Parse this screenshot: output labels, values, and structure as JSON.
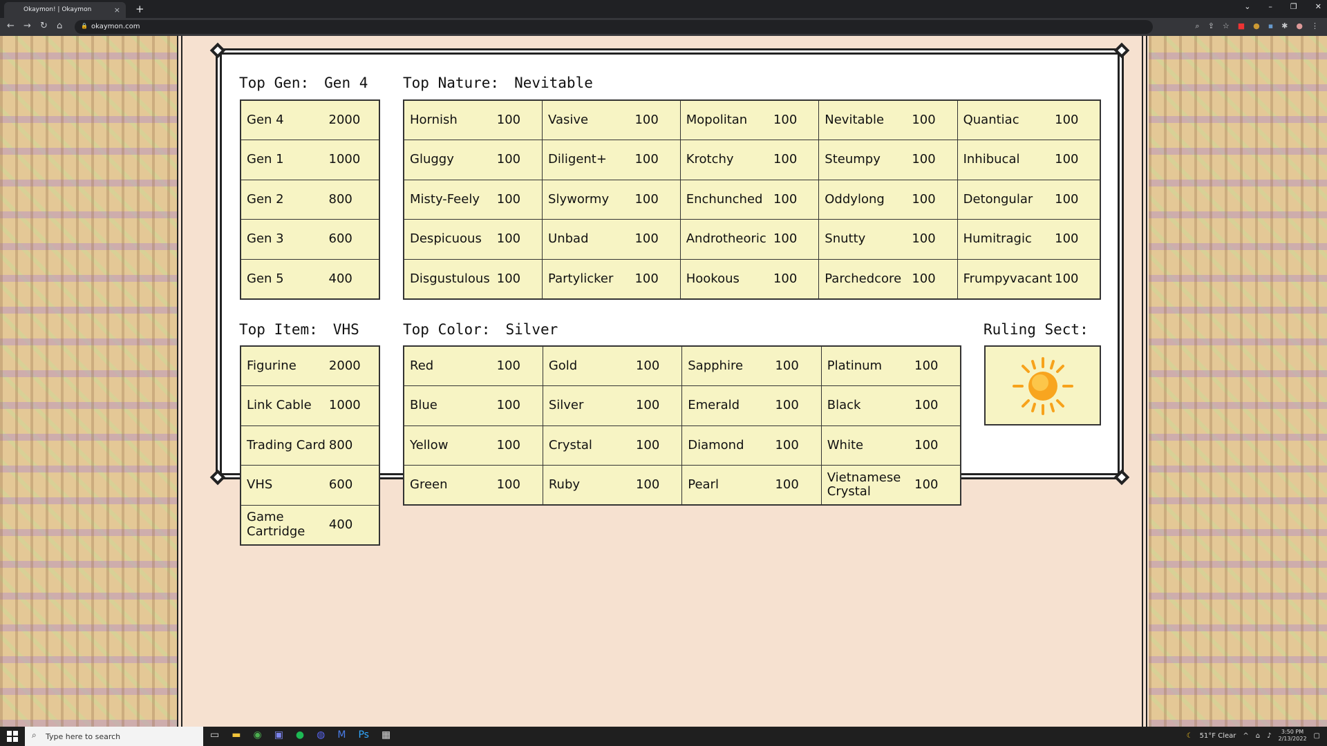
{
  "browser": {
    "tab_title": "Okaymon! | Okaymon",
    "url": "okaymon.com",
    "new_tab": "+",
    "tab_close": "×"
  },
  "panel": {
    "gen": {
      "label": "Top Gen:",
      "value": "Gen 4",
      "rows": [
        {
          "name": "Gen 4",
          "value": "2000"
        },
        {
          "name": "Gen 1",
          "value": "1000"
        },
        {
          "name": "Gen 2",
          "value": "800"
        },
        {
          "name": "Gen 3",
          "value": "600"
        },
        {
          "name": "Gen 5",
          "value": "400"
        }
      ]
    },
    "nature": {
      "label": "Top Nature:",
      "value": "Nevitable",
      "rows": [
        [
          {
            "name": "Hornish",
            "value": "100"
          },
          {
            "name": "Vasive",
            "value": "100"
          },
          {
            "name": "Mopolitan",
            "value": "100"
          },
          {
            "name": "Nevitable",
            "value": "100"
          },
          {
            "name": "Quantiac",
            "value": "100"
          }
        ],
        [
          {
            "name": "Gluggy",
            "value": "100"
          },
          {
            "name": "Diligent+",
            "value": "100"
          },
          {
            "name": "Krotchy",
            "value": "100"
          },
          {
            "name": "Steumpy",
            "value": "100"
          },
          {
            "name": "Inhibucal",
            "value": "100"
          }
        ],
        [
          {
            "name": "Misty-Feely",
            "value": "100"
          },
          {
            "name": "Slywormy",
            "value": "100"
          },
          {
            "name": "Enchunched",
            "value": "100"
          },
          {
            "name": "Oddylong",
            "value": "100"
          },
          {
            "name": "Detongular",
            "value": "100"
          }
        ],
        [
          {
            "name": "Despicuous",
            "value": "100"
          },
          {
            "name": "Unbad",
            "value": "100"
          },
          {
            "name": "Androtheoric",
            "value": "100"
          },
          {
            "name": "Snutty",
            "value": "100"
          },
          {
            "name": "Humitragic",
            "value": "100"
          }
        ],
        [
          {
            "name": "Disgustulous",
            "value": "100"
          },
          {
            "name": "Partylicker",
            "value": "100"
          },
          {
            "name": "Hookous",
            "value": "100"
          },
          {
            "name": "Parchedcore",
            "value": "100"
          },
          {
            "name": "Frumpyvacant",
            "value": "100"
          }
        ]
      ]
    },
    "item": {
      "label": "Top Item:",
      "value": "VHS",
      "rows": [
        {
          "name": "Figurine",
          "value": "2000"
        },
        {
          "name": "Link Cable",
          "value": "1000"
        },
        {
          "name": "Trading Card",
          "value": "800"
        },
        {
          "name": "VHS",
          "value": "600"
        },
        {
          "name": "Game Cartridge",
          "value": "400"
        }
      ]
    },
    "color": {
      "label": "Top Color:",
      "value": "Silver",
      "rows": [
        [
          {
            "name": "Red",
            "value": "100"
          },
          {
            "name": "Gold",
            "value": "100"
          },
          {
            "name": "Sapphire",
            "value": "100"
          },
          {
            "name": "Platinum",
            "value": "100"
          }
        ],
        [
          {
            "name": "Blue",
            "value": "100"
          },
          {
            "name": "Silver",
            "value": "100"
          },
          {
            "name": "Emerald",
            "value": "100"
          },
          {
            "name": "Black",
            "value": "100"
          }
        ],
        [
          {
            "name": "Yellow",
            "value": "100"
          },
          {
            "name": "Crystal",
            "value": "100"
          },
          {
            "name": "Diamond",
            "value": "100"
          },
          {
            "name": "White",
            "value": "100"
          }
        ],
        [
          {
            "name": "Green",
            "value": "100"
          },
          {
            "name": "Ruby",
            "value": "100"
          },
          {
            "name": "Pearl",
            "value": "100"
          },
          {
            "name": "Vietnamese Crystal",
            "value": "100"
          }
        ]
      ]
    },
    "sect": {
      "label": "Ruling Sect:",
      "icon": "sun-icon"
    }
  },
  "taskbar": {
    "search_placeholder": "Type here to search",
    "weather": "51°F  Clear",
    "time": "3:50 PM",
    "date": "2/13/2022"
  },
  "colors": {
    "cell_bg": "#f7f4c4",
    "page_bg": "#f6e1d0",
    "sun": "#f7a21b"
  }
}
